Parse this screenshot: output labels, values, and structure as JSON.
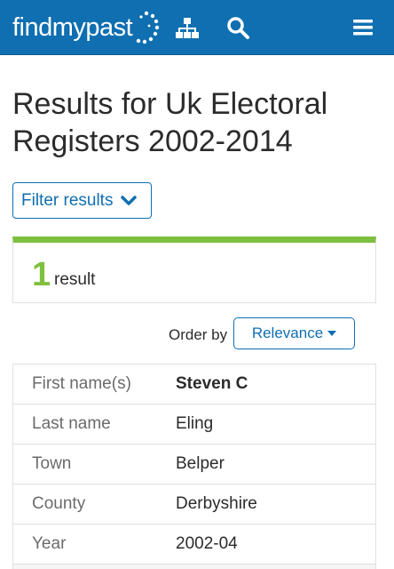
{
  "header": {
    "logo_text": "findmypast",
    "icons": [
      "logo-dots-icon",
      "hierarchy-icon",
      "search-icon",
      "menu-icon"
    ],
    "color": "#0f6fb1"
  },
  "page_title": "Results for Uk Electoral Registers 2002-2014",
  "filter_label": "Filter results",
  "results": {
    "count": "1",
    "label": "result",
    "accent_color": "#7fbf3f"
  },
  "order": {
    "label": "Order by",
    "selected": "Relevance"
  },
  "record": {
    "rows": [
      {
        "key": "First name(s)",
        "value": "Steven C"
      },
      {
        "key": "Last name",
        "value": "Eling"
      },
      {
        "key": "Town",
        "value": "Belper"
      },
      {
        "key": "County",
        "value": "Derbyshire"
      },
      {
        "key": "Year",
        "value": "2002-04"
      }
    ]
  }
}
